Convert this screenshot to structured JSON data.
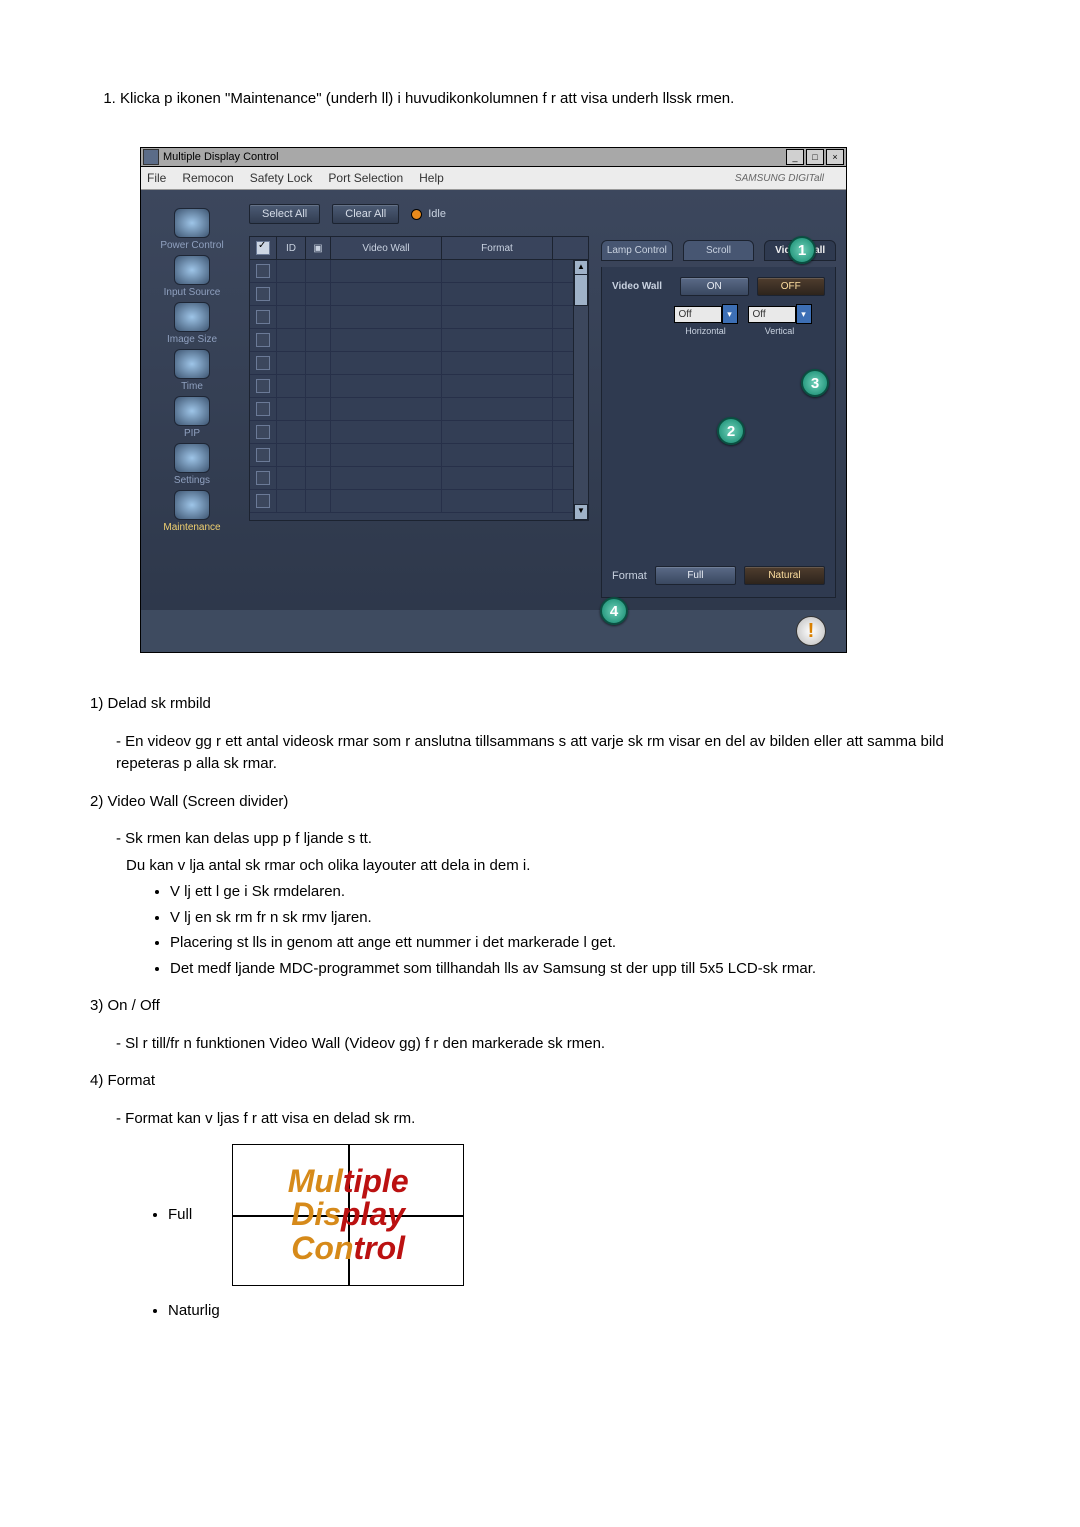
{
  "intro_list": {
    "item1": "Klicka p  ikonen \"Maintenance\" (underh ll) i huvudikonkolumnen f r att visa underh llssk rmen."
  },
  "window": {
    "title": "Multiple Display Control",
    "menu": {
      "file": "File",
      "remocon": "Remocon",
      "safety": "Safety Lock",
      "port": "Port Selection",
      "help": "Help"
    },
    "brand": "SAMSUNG DIGITall",
    "buttons": {
      "select_all": "Select All",
      "clear_all": "Clear All",
      "idle": "Idle"
    },
    "columns": {
      "chk": "☑",
      "id": "ID",
      "info": "ℹ",
      "video_wall": "Video Wall",
      "format": "Format"
    },
    "sidebar": {
      "power": "Power Control",
      "input": "Input Source",
      "image": "Image Size",
      "time": "Time",
      "pip": "PIP",
      "settings": "Settings",
      "maintenance": "Maintenance"
    },
    "tabs": {
      "lamp": "Lamp Control",
      "scroll": "Scroll",
      "videowall": "Video Wall"
    },
    "panel": {
      "video_wall_label": "Video Wall",
      "on": "ON",
      "off": "OFF",
      "sel_left": "Off",
      "sel_right": "Off",
      "sel_left_lab": "Horizontal",
      "sel_right_lab": "Vertical",
      "format_label": "Format",
      "full": "Full",
      "natural": "Natural"
    }
  },
  "callouts": {
    "c1": "1",
    "c2": "2",
    "c3": "3",
    "c4": "4"
  },
  "desc": {
    "h1": "1)  Delad sk rmbild",
    "h1_p1": "- En videov gg  r ett antal videosk rmar som  r anslutna tillsammans s  att varje sk rm visar en del av bilden eller att samma bild repeteras p  alla sk rmar.",
    "h2": "2)  Video Wall (Screen divider)",
    "h2_p1": "- Sk rmen kan delas upp p  f ljande s tt.",
    "h2_p2": "Du kan v lja antal sk rmar och olika layouter att dela in dem i.",
    "h2_b1": "V lj ett l ge i Sk rmdelaren.",
    "h2_b2": "V lj en sk rm fr n sk rmv ljaren.",
    "h2_b3": "Placering st lls in genom att ange ett nummer i det markerade l get.",
    "h2_b4": "Det medf ljande MDC-programmet som tillhandah lls av Samsung st der upp till 5x5 LCD-sk rmar.",
    "h3": "3)  On / Off",
    "h3_p1": "- Sl r till/fr n funktionen Video Wall (Videov    gg) f r den markerade sk rmen.",
    "h4": "4)  Format",
    "h4_p1": "- Format kan v ljas f r att visa en delad sk rm.",
    "full": "Full",
    "mdc_text": "Multiple Display Control",
    "natural": "Naturlig"
  }
}
